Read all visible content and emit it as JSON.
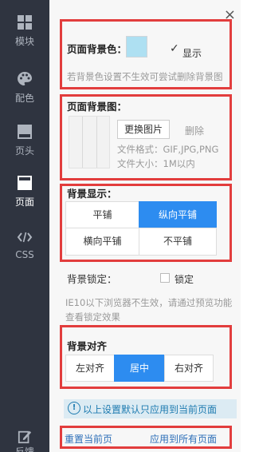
{
  "sidebar": {
    "items": [
      {
        "label": "模块",
        "icon": "grid-icon"
      },
      {
        "label": "配色",
        "icon": "palette-icon"
      },
      {
        "label": "页头",
        "icon": "header-icon"
      },
      {
        "label": "页面",
        "icon": "page-icon",
        "active": true
      },
      {
        "label": "CSS",
        "icon": "code-icon"
      },
      {
        "label": "反馈",
        "icon": "edit-icon"
      }
    ]
  },
  "panel": {
    "close_label": "×",
    "bg_color": {
      "title": "页面背景色：",
      "swatch_color": "#aee0f2",
      "show_label": "显示",
      "show_checked": true,
      "hint": "若背景色设置不生效可尝试删除背景图"
    },
    "bg_image": {
      "title": "页面背景图：",
      "change_button": "更换图片",
      "delete_label": "删除",
      "format_text": "文件格式：GIF,JPG,PNG",
      "size_text": "文件大小：1M以内"
    },
    "bg_display": {
      "title": "背景显示：",
      "options": [
        "平铺",
        "纵向平铺",
        "横向平铺",
        "不平铺"
      ],
      "selected": "纵向平铺"
    },
    "bg_lock": {
      "title": "背景锁定：",
      "checkbox_label": "锁定",
      "checked": false,
      "hint_line1": "IE10以下浏览器不生效，请通过预览功能",
      "hint_line2": "查看锁定效果"
    },
    "bg_align": {
      "title": "背景对齐",
      "options": [
        "左对齐",
        "居中",
        "右对齐"
      ],
      "selected": "居中"
    },
    "notice": "以上设置默认只应用到当前页面",
    "footer": {
      "reset_label": "重置当前页",
      "apply_all_label": "应用到所有页面"
    }
  },
  "colors": {
    "sidebar_bg": "#2f3440",
    "accent_blue": "#2d8cf0",
    "highlight_red": "#e23d3d",
    "link_blue": "#2d6fb8"
  }
}
